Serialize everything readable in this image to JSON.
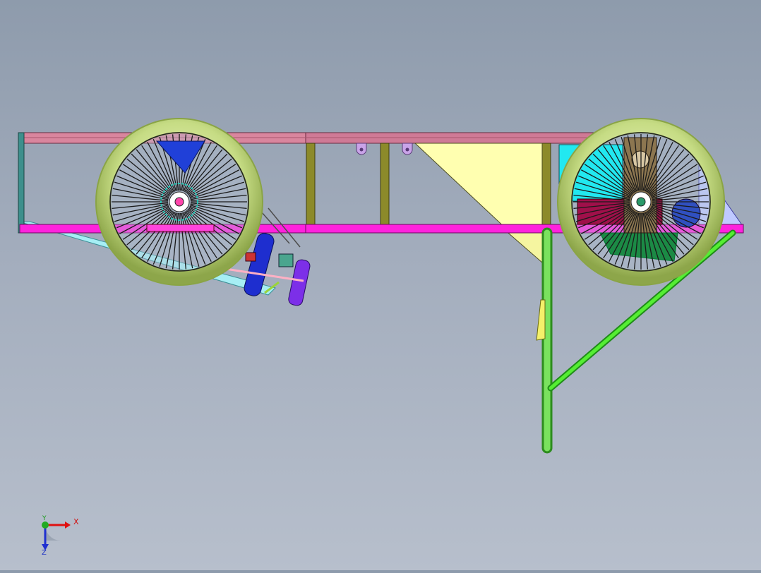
{
  "window": {
    "background_top": "#8e9bac",
    "background_bottom": "#b7bfcc"
  },
  "model": {
    "frame_rail_color": "#ff22dd",
    "top_rail_color": "#d9869e",
    "tire_color": "#c9e08a",
    "roll_bar_color": "#33dd22",
    "plate_color": "#ffffb0"
  },
  "triad": {
    "x_label": "X",
    "y_label": "Y",
    "z_label": "Z",
    "x_color": "#e01010",
    "y_color": "#22aa22",
    "z_color": "#2030d0"
  }
}
